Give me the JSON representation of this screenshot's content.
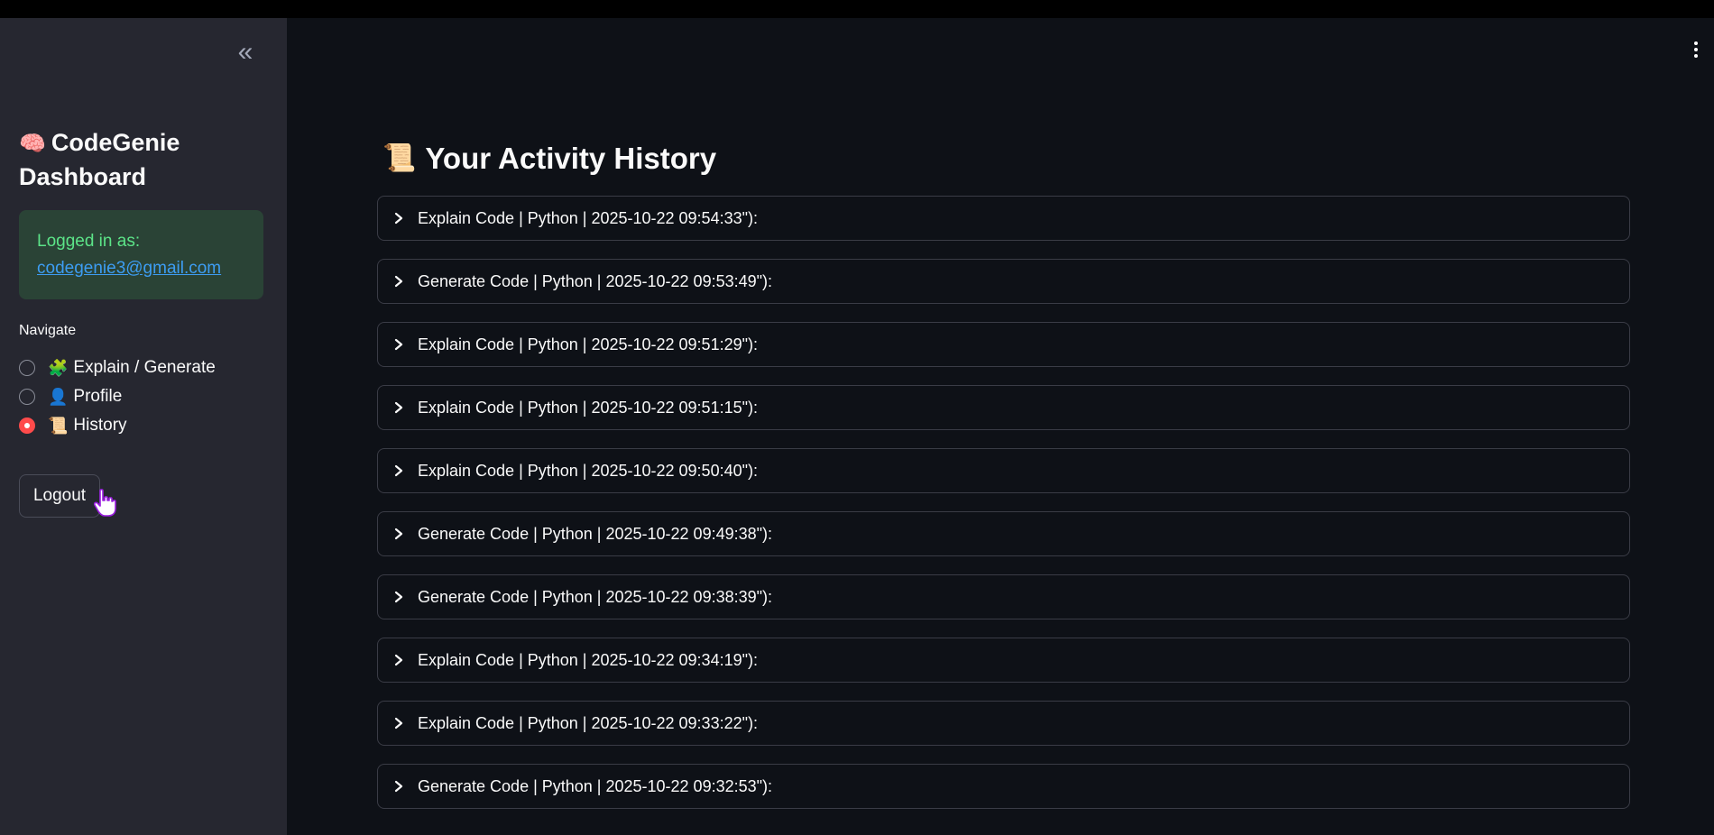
{
  "sidebar": {
    "collapse_icon": "chevrons-left-icon",
    "brand": {
      "emoji": "🧠",
      "title": "CodeGenie Dashboard"
    },
    "login": {
      "label": "Logged in as:",
      "email": "codegenie3@gmail.com"
    },
    "nav": {
      "label": "Navigate",
      "items": [
        {
          "emoji": "🧩",
          "label": "Explain / Generate",
          "selected": false
        },
        {
          "emoji": "👤",
          "label": "Profile",
          "selected": false
        },
        {
          "emoji": "📜",
          "label": "History",
          "selected": true
        }
      ]
    },
    "logout_label": "Logout"
  },
  "header": {
    "menu_icon": "kebab-menu-icon"
  },
  "main": {
    "title_emoji": "📜",
    "title": "Your Activity History",
    "history": [
      {
        "label": "Explain Code | Python | 2025-10-22 09:54:33\"):"
      },
      {
        "label": "Generate Code | Python | 2025-10-22 09:53:49\"):"
      },
      {
        "label": "Explain Code | Python | 2025-10-22 09:51:29\"):"
      },
      {
        "label": "Explain Code | Python | 2025-10-22 09:51:15\"):"
      },
      {
        "label": "Explain Code | Python | 2025-10-22 09:50:40\"):"
      },
      {
        "label": "Generate Code | Python | 2025-10-22 09:49:38\"):"
      },
      {
        "label": "Generate Code | Python | 2025-10-22 09:38:39\"):"
      },
      {
        "label": "Explain Code | Python | 2025-10-22 09:34:19\"):"
      },
      {
        "label": "Explain Code | Python | 2025-10-22 09:33:22\"):"
      },
      {
        "label": "Generate Code | Python | 2025-10-22 09:32:53\"):"
      }
    ]
  },
  "colors": {
    "sidebar_bg": "#262730",
    "main_bg": "#0e1117",
    "success_bg": "#2a4336",
    "success_text": "#5ce488",
    "link": "#3d9df3",
    "accent": "#ff4b4b"
  }
}
